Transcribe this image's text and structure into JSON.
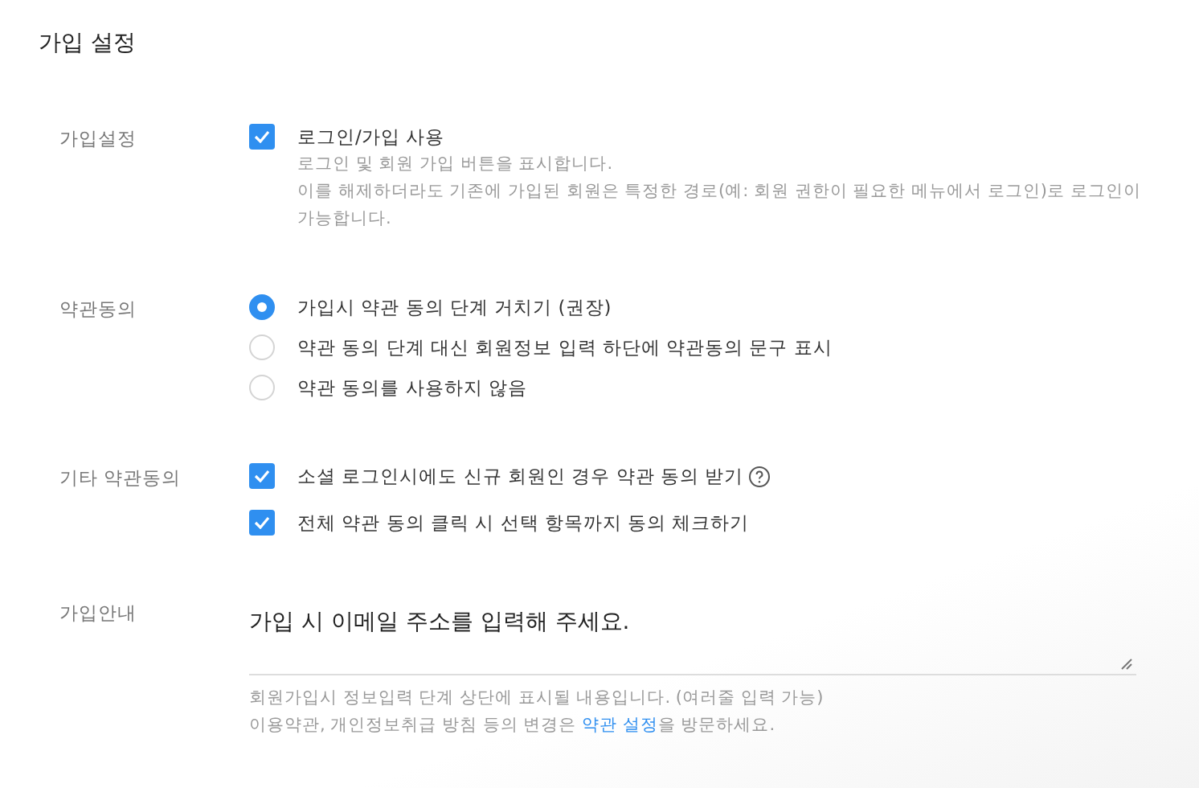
{
  "title": "가입 설정",
  "sections": [
    {
      "kind": "checks",
      "label": "가입설정",
      "items": [
        {
          "label": "로그인/가입 사용",
          "checked": true,
          "help": false,
          "notes": [
            "로그인 및 회원 가입 버튼을 표시합니다.",
            "이를 해제하더라도 기존에 가입된 회원은 특정한 경로(예: 회원 권한이 필요한 메뉴에서 로그인)로 로그인이 가능합니다."
          ]
        }
      ]
    },
    {
      "kind": "radios",
      "label": "약관동의",
      "items": [
        {
          "label": "가입시 약관 동의 단계 거치기 (권장)",
          "selected": true
        },
        {
          "label": "약관 동의 단계 대신 회원정보 입력 하단에 약관동의 문구 표시",
          "selected": false
        },
        {
          "label": "약관 동의를 사용하지 않음",
          "selected": false
        }
      ]
    },
    {
      "kind": "checks",
      "label": "기타 약관동의",
      "items": [
        {
          "label": "소셜 로그인시에도 신규 회원인 경우 약관 동의 받기",
          "checked": true,
          "help": true
        },
        {
          "label": "전체 약관 동의 클릭 시 선택 항목까지 동의 체크하기",
          "checked": true,
          "help": false
        }
      ]
    },
    {
      "kind": "textarea",
      "label": "가입안내",
      "value": "가입 시 이메일 주소를 입력해 주세요.",
      "notes": [
        {
          "parts": [
            {
              "text": "회원가입시 정보입력 단계 상단에 표시될 내용입니다. (여러줄 입력 가능)",
              "link": false
            }
          ]
        },
        {
          "parts": [
            {
              "text": "이용약관, 개인정보취급 방침 등의 변경은 ",
              "link": false
            },
            {
              "text": "약관 설정",
              "link": true
            },
            {
              "text": "을 방문하세요.",
              "link": false
            }
          ]
        }
      ]
    }
  ]
}
